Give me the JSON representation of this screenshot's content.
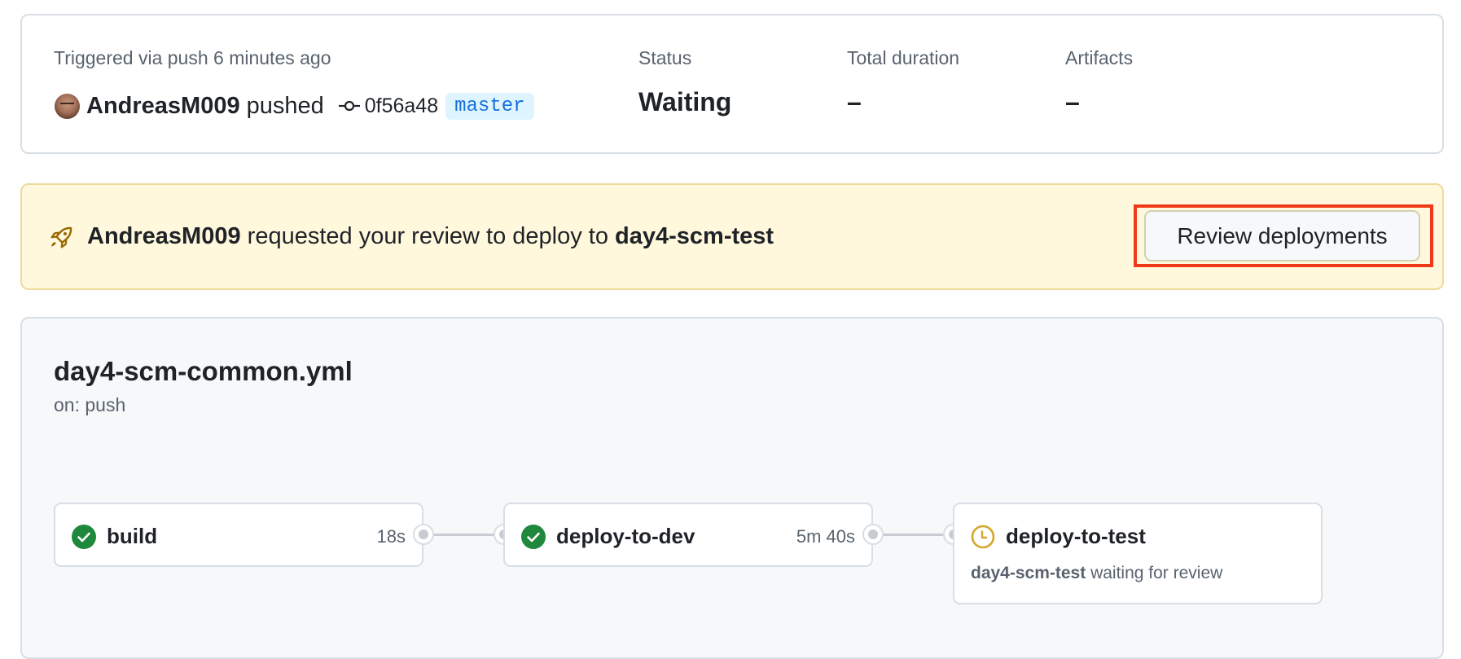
{
  "summary": {
    "triggered_label": "Triggered via push 6 minutes ago",
    "actor": "AndreasM009",
    "action": "pushed",
    "commit_sha": "0f56a48",
    "branch": "master",
    "status_label": "Status",
    "status_value": "Waiting",
    "duration_label": "Total duration",
    "duration_value": "–",
    "artifacts_label": "Artifacts",
    "artifacts_value": "–"
  },
  "review_banner": {
    "icon": "rocket-icon",
    "actor": "AndreasM009",
    "message": "requested your review to deploy to",
    "environment": "day4-scm-test",
    "button_label": "Review deployments",
    "accent_color": "#9a6700",
    "highlight_color": "#f03a17"
  },
  "workflow": {
    "file": "day4-scm-common.yml",
    "trigger": "on: push",
    "jobs": [
      {
        "name": "build",
        "status": "success",
        "duration": "18s"
      },
      {
        "name": "deploy-to-dev",
        "status": "success",
        "duration": "5m 40s"
      },
      {
        "name": "deploy-to-test",
        "status": "waiting",
        "environment": "day4-scm-test",
        "detail": "waiting for review"
      }
    ],
    "colors": {
      "success": "#1f883d",
      "waiting": "#d4a72c"
    }
  }
}
